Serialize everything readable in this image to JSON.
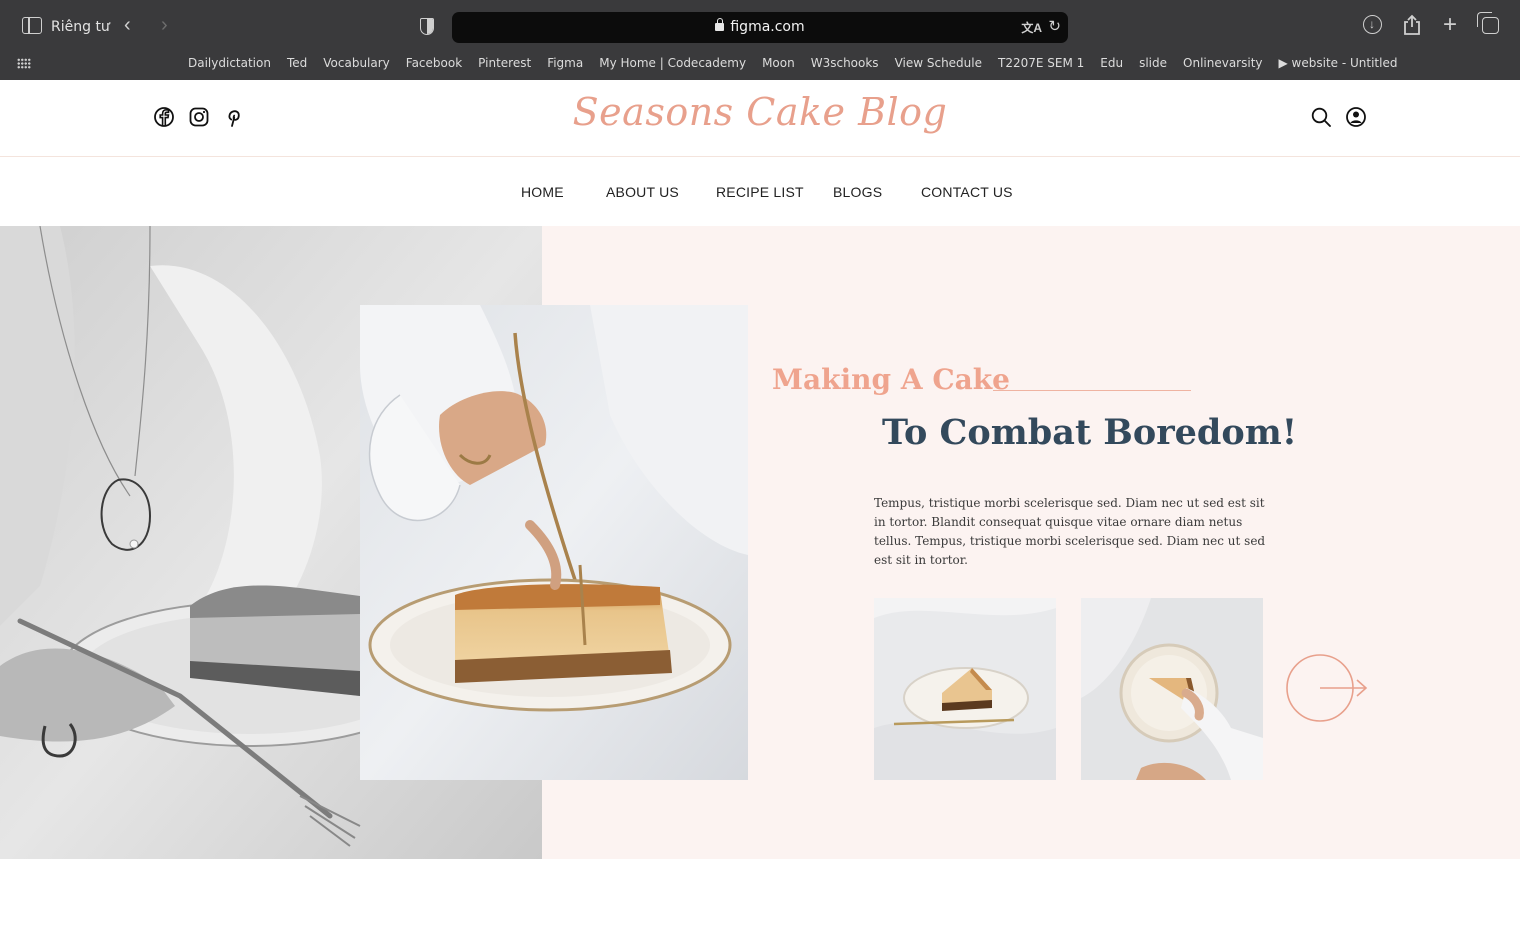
{
  "browser": {
    "private_label": "Riêng tư",
    "url": "figma.com",
    "bookmarks": [
      "Dailydictation",
      "Ted",
      "Vocabulary",
      "Facebook",
      "Pinterest",
      "Figma",
      "My Home | Codecademy",
      "Moon",
      "W3schooks",
      "View Schedule",
      "T2207E SEM 1",
      "Edu",
      "slide",
      "Onlinevarsity",
      "▶ website - Untitled"
    ]
  },
  "site": {
    "logo": "Seasons Cake Blog",
    "nav": [
      "HOME",
      "ABOUT US",
      "RECIPE LIST",
      "BLOGS",
      "CONTACT US"
    ],
    "colors": {
      "accent": "#e8a08c",
      "heading": "#33495c",
      "hero_bg": "#fcf3f1"
    }
  },
  "hero": {
    "kicker": "Making A Cake",
    "headline": "To Combat Boredom!",
    "body": "Tempus, tristique morbi scelerisque sed. Diam nec ut sed est sit in tortor. Blandit consequat quisque vitae ornare diam netus tellus. Tempus, tristique morbi scelerisque sed. Diam nec ut sed est sit in tortor."
  }
}
